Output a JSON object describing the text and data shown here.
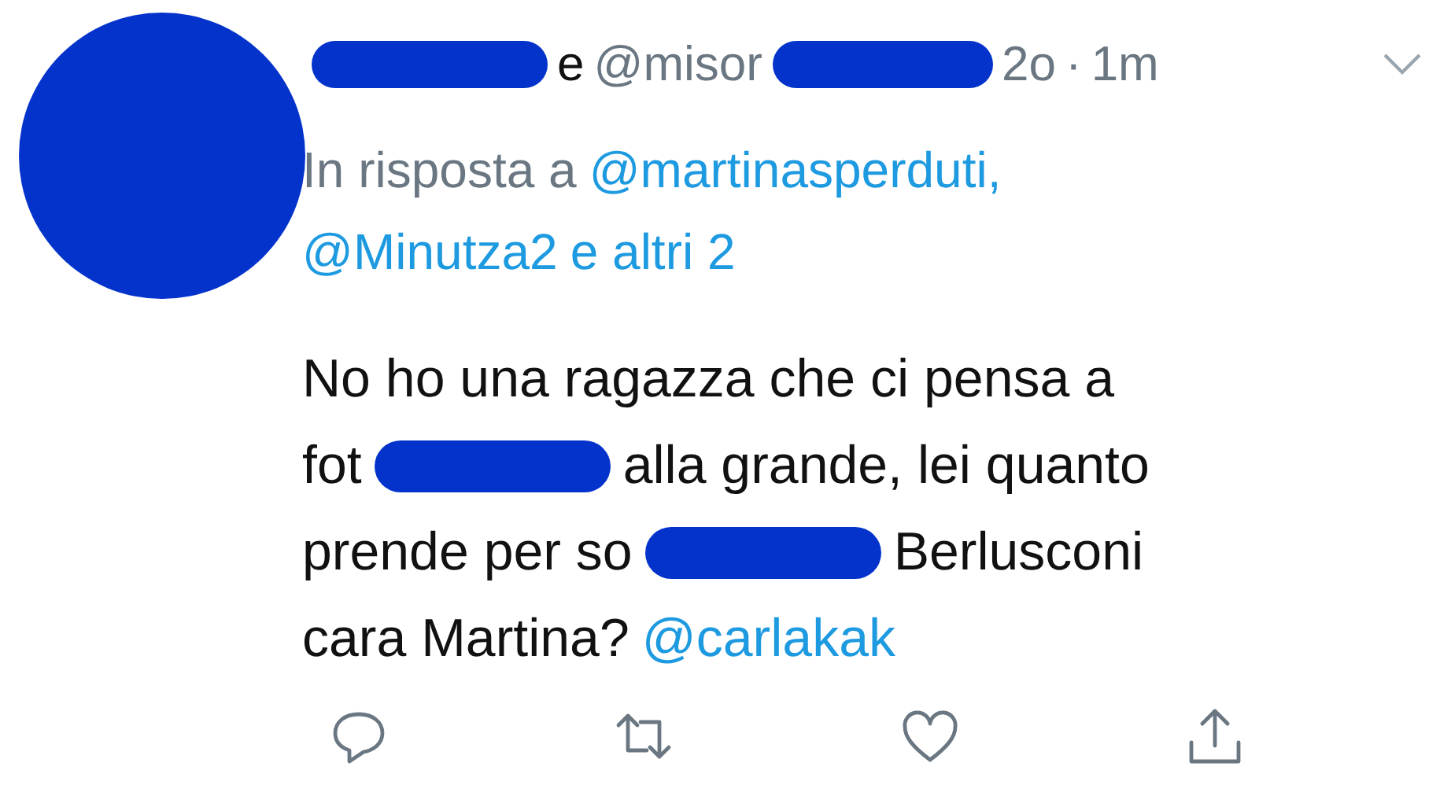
{
  "header": [
    {
      "kind": "redacted"
    },
    {
      "kind": "name",
      "text": "e"
    },
    {
      "kind": "handle",
      "text": "@misor"
    },
    {
      "kind": "redacted"
    },
    {
      "kind": "handle",
      "text": "2o"
    },
    {
      "kind": "handle",
      "text": "·"
    },
    {
      "kind": "handle",
      "text": "1m"
    }
  ],
  "reply_to": [
    [
      {
        "kind": "text",
        "text": "In risposta a"
      },
      {
        "kind": "link",
        "text": "@martinasperduti,"
      }
    ],
    [
      {
        "kind": "link",
        "text": "@Minutza2"
      },
      {
        "kind": "link",
        "text": "e altri 2"
      }
    ]
  ],
  "body_lines": [
    [
      {
        "kind": "text",
        "text": "No ho una ragazza che ci pensa a"
      }
    ],
    [
      {
        "kind": "text",
        "text": "fot"
      },
      {
        "kind": "redacted"
      },
      {
        "kind": "text",
        "text": "alla grande, lei quanto"
      }
    ],
    [
      {
        "kind": "text",
        "text": "prende per so"
      },
      {
        "kind": "redacted"
      },
      {
        "kind": "text",
        "text": "Berlusconi"
      }
    ],
    [
      {
        "kind": "text",
        "text": "cara Martina?"
      },
      {
        "kind": "link",
        "text": "@carlakak"
      }
    ]
  ],
  "actions": [
    {
      "kind": "reply"
    },
    {
      "kind": "retweet"
    },
    {
      "kind": "like"
    },
    {
      "kind": "share"
    }
  ]
}
